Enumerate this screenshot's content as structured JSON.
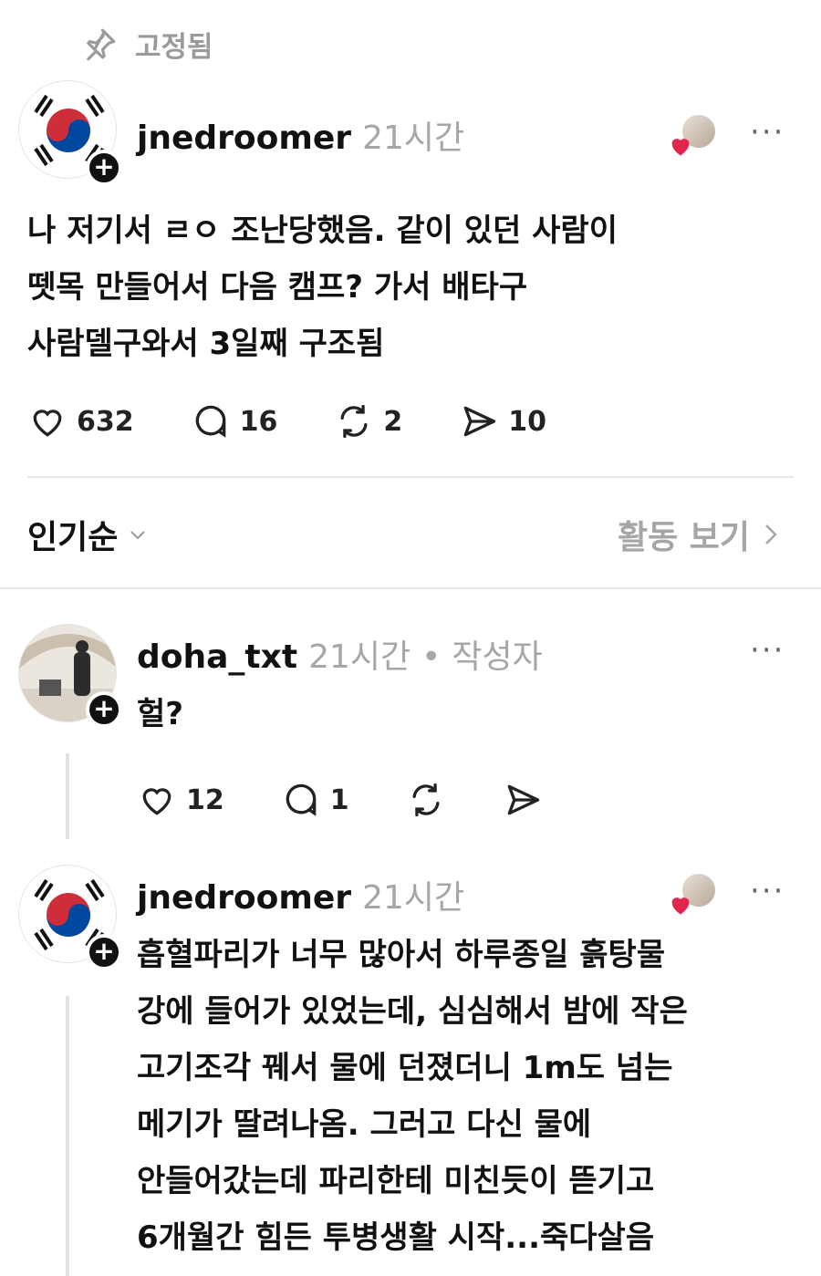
{
  "pinned_label": "고정됨",
  "post": {
    "username": "jnedroomer",
    "time": "21시간",
    "lines": [
      "나 저기서 ㄹㅇ 조난당했음. 같이 있던 사람이",
      "뗏목 만들어서 다음 캠프? 가서 배타구",
      "사람델구와서 3일째 구조됨"
    ],
    "likes": "632",
    "comments": "16",
    "reposts": "2",
    "shares": "10"
  },
  "sort": {
    "label": "인기순",
    "activity": "활동 보기"
  },
  "reply1": {
    "username": "doha_txt",
    "time": "21시간",
    "author_badge": "작성자",
    "text": "헐?",
    "likes": "12",
    "comments": "1"
  },
  "reply2": {
    "username": "jnedroomer",
    "time": "21시간",
    "lines": [
      "흡혈파리가 너무 많아서 하루종일 흙탕물",
      "강에 들어가 있었는데, 심심해서 밤에 작은",
      "고기조각 꿰서 물에 던졌더니 1m도 넘는",
      "메기가 딸려나옴. 그러고 다신 물에",
      "안들어갔는데 파리한테 미친듯이 뜯기고",
      "6개월간 힘든 투병생활 시작...죽다살음"
    ]
  },
  "more_label": "···",
  "colors": {
    "text": "#111111",
    "muted": "#a6a6a6",
    "heart_badge": "#e0264a"
  }
}
